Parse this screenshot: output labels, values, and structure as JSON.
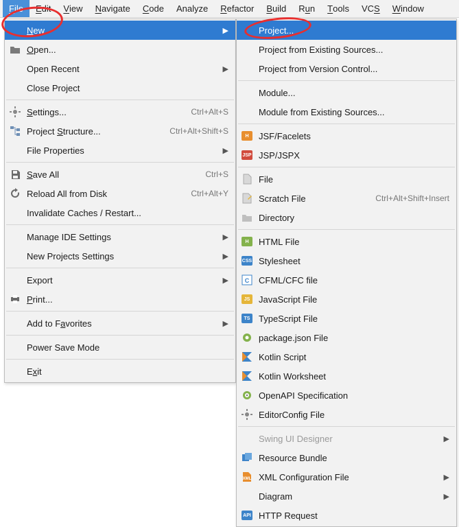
{
  "menubar": [
    {
      "label": "File",
      "u": 0,
      "open": true
    },
    {
      "label": "Edit",
      "u": 0
    },
    {
      "label": "View",
      "u": 0
    },
    {
      "label": "Navigate",
      "u": 0
    },
    {
      "label": "Code",
      "u": 0
    },
    {
      "label": "Analyze",
      "u": -1
    },
    {
      "label": "Refactor",
      "u": 0
    },
    {
      "label": "Build",
      "u": 0
    },
    {
      "label": "Run",
      "u": 1
    },
    {
      "label": "Tools",
      "u": 0
    },
    {
      "label": "VCS",
      "u": 2
    },
    {
      "label": "Window",
      "u": 0
    }
  ],
  "file_menu": [
    {
      "label": "New",
      "u": 0,
      "selected": true,
      "submenu": true,
      "name": "file-new"
    },
    {
      "label": "Open...",
      "u": 0,
      "icon": "folder",
      "name": "file-open"
    },
    {
      "label": "Open Recent",
      "submenu": true,
      "name": "file-open-recent"
    },
    {
      "label": "Close Project",
      "name": "file-close-project"
    },
    {
      "sep": true
    },
    {
      "label": "Settings...",
      "u": 0,
      "icon": "gear",
      "shortcut": "Ctrl+Alt+S",
      "name": "file-settings"
    },
    {
      "label": "Project Structure...",
      "u": 8,
      "icon": "tree",
      "shortcut": "Ctrl+Alt+Shift+S",
      "name": "file-project-structure"
    },
    {
      "label": "File Properties",
      "submenu": true,
      "name": "file-properties"
    },
    {
      "sep": true
    },
    {
      "label": "Save All",
      "u": 0,
      "icon": "disk",
      "shortcut": "Ctrl+S",
      "name": "file-save-all"
    },
    {
      "label": "Reload All from Disk",
      "icon": "reload",
      "shortcut": "Ctrl+Alt+Y",
      "name": "file-reload"
    },
    {
      "label": "Invalidate Caches / Restart...",
      "name": "file-invalidate"
    },
    {
      "sep": true
    },
    {
      "label": "Manage IDE Settings",
      "submenu": true,
      "name": "file-manage-ide"
    },
    {
      "label": "New Projects Settings",
      "submenu": true,
      "name": "file-new-proj-settings"
    },
    {
      "sep": true
    },
    {
      "label": "Export",
      "submenu": true,
      "name": "file-export"
    },
    {
      "label": "Print...",
      "u": 0,
      "icon": "print",
      "name": "file-print"
    },
    {
      "sep": true
    },
    {
      "label": "Add to Favorites",
      "u": 8,
      "submenu": true,
      "name": "file-add-fav"
    },
    {
      "sep": true
    },
    {
      "label": "Power Save Mode",
      "name": "file-power-save"
    },
    {
      "sep": true
    },
    {
      "label": "Exit",
      "u": 1,
      "name": "file-exit"
    }
  ],
  "new_submenu": [
    {
      "label": "Project...",
      "selected": true,
      "name": "new-project"
    },
    {
      "label": "Project from Existing Sources...",
      "name": "new-proj-existing"
    },
    {
      "label": "Project from Version Control...",
      "name": "new-proj-vcs"
    },
    {
      "sep": true
    },
    {
      "label": "Module...",
      "name": "new-module"
    },
    {
      "label": "Module from Existing Sources...",
      "name": "new-module-existing"
    },
    {
      "sep": true
    },
    {
      "label": "JSF/Facelets",
      "icon": "badge-orange",
      "badge": "H",
      "name": "new-jsf"
    },
    {
      "label": "JSP/JSPX",
      "icon": "badge-red",
      "badge": "JSP",
      "name": "new-jsp"
    },
    {
      "sep": true
    },
    {
      "label": "File",
      "icon": "file",
      "name": "new-file"
    },
    {
      "label": "Scratch File",
      "icon": "scratch",
      "shortcut": "Ctrl+Alt+Shift+Insert",
      "name": "new-scratch"
    },
    {
      "label": "Directory",
      "icon": "dir",
      "name": "new-dir"
    },
    {
      "sep": true
    },
    {
      "label": "HTML File",
      "icon": "badge-green",
      "badge": "H",
      "name": "new-html"
    },
    {
      "label": "Stylesheet",
      "icon": "badge-blue",
      "badge": "CSS",
      "name": "new-css"
    },
    {
      "label": "CFML/CFC file",
      "icon": "cf-icon",
      "name": "new-cfml"
    },
    {
      "label": "JavaScript File",
      "icon": "badge-yellow",
      "badge": "JS",
      "name": "new-js"
    },
    {
      "label": "TypeScript File",
      "icon": "badge-blue",
      "badge": "TS",
      "name": "new-ts"
    },
    {
      "label": "package.json File",
      "icon": "npm-icon",
      "name": "new-pkgjson"
    },
    {
      "label": "Kotlin Script",
      "icon": "kotlin-icon",
      "name": "new-kts"
    },
    {
      "label": "Kotlin Worksheet",
      "icon": "kotlin-icon",
      "name": "new-ktw"
    },
    {
      "label": "OpenAPI Specification",
      "icon": "openapi-icon",
      "name": "new-openapi"
    },
    {
      "label": "EditorConfig File",
      "icon": "gear-gray",
      "name": "new-editorconfig"
    },
    {
      "sep": true
    },
    {
      "label": "Swing UI Designer",
      "submenu": true,
      "disabled": true,
      "name": "new-swing"
    },
    {
      "label": "Resource Bundle",
      "icon": "bundle-icon",
      "name": "new-bundle"
    },
    {
      "label": "XML Configuration File",
      "icon": "xml-icon",
      "submenu": true,
      "name": "new-xml-config"
    },
    {
      "label": "Diagram",
      "submenu": true,
      "name": "new-diagram"
    },
    {
      "label": "HTTP Request",
      "icon": "badge-blue",
      "badge": "API",
      "name": "new-http"
    }
  ]
}
